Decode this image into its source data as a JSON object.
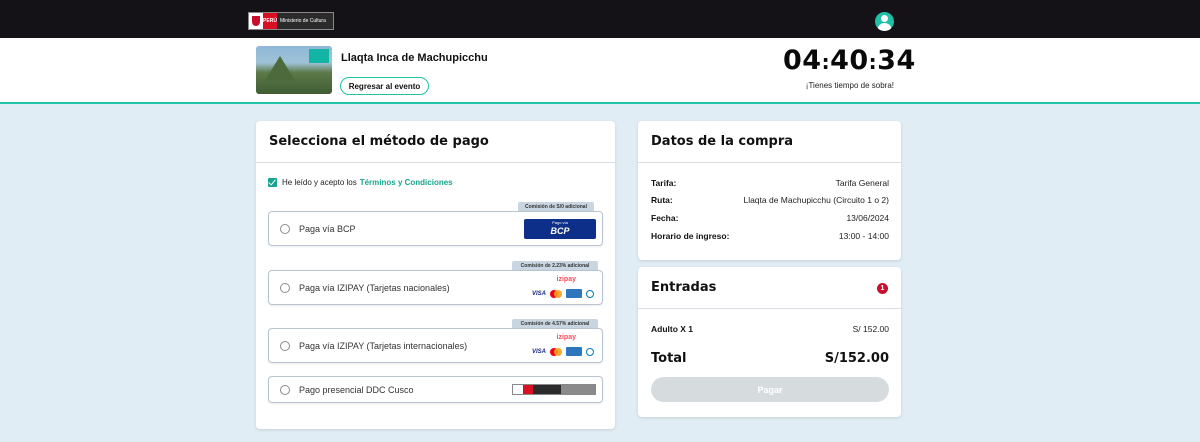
{
  "header": {
    "logo": {
      "country": "PERÚ",
      "ministry": "Ministerio de Cultura"
    },
    "icons": {
      "user": "user-avatar-icon"
    }
  },
  "event": {
    "title": "Llaqta Inca de Machupicchu",
    "back_label": "Regresar al evento",
    "timer": {
      "hours": "04",
      "minutes": "40",
      "seconds": "34",
      "separator": ":"
    },
    "timer_note": "¡Tienes tiempo de sobra!"
  },
  "payment": {
    "title": "Selecciona el método de pago",
    "terms_prefix": "He leído y acepto los",
    "terms_link": "Términos y Condiciones",
    "options": [
      {
        "label": "Paga vía BCP",
        "fee": "Comisión de S/0 adicional",
        "logo_small": "Pago vía",
        "logo_big": "BCP"
      },
      {
        "label": "Paga vía IZIPAY (Tarjetas nacionales)",
        "fee": "Comisión de 2.23% adicional",
        "logo_name": "izipay",
        "visa": "VISA"
      },
      {
        "label": "Paga vía IZIPAY (Tarjetas internacionales)",
        "fee": "Comisión de 4.57% adicional",
        "logo_name": "izipay",
        "visa": "VISA"
      },
      {
        "label": "Pago presencial DDC Cusco"
      }
    ],
    "accent_color": "#17a58f"
  },
  "summary": {
    "title": "Datos de la compra",
    "rows": [
      {
        "key": "Tarifa:",
        "value": "Tarifa General"
      },
      {
        "key": "Ruta:",
        "value": "Llaqta de Machupicchu (Circuito 1 o 2)"
      },
      {
        "key": "Fecha:",
        "value": "13/06/2024"
      },
      {
        "key": "Horario de ingreso:",
        "value": "13:00 - 14:00"
      }
    ]
  },
  "tickets": {
    "title": "Entradas",
    "count": "1",
    "line": {
      "key": "Adulto X 1",
      "value": "S/ 152.00"
    },
    "total_label": "Total",
    "total_value": "S/152.00",
    "pay_label": "Pagar"
  }
}
